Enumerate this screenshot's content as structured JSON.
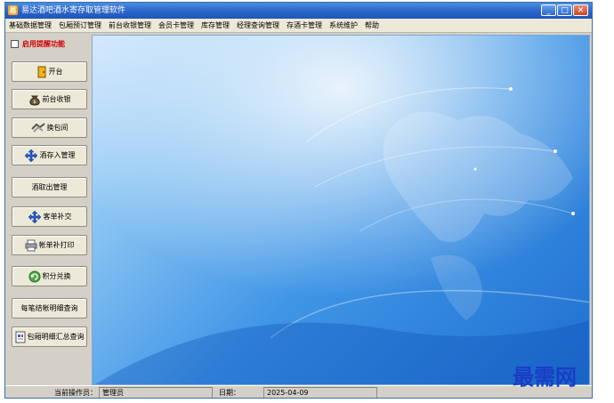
{
  "window": {
    "title": "易达酒吧酒水寄存取管理软件",
    "app_icon_glyph": "易"
  },
  "window_controls": {
    "minimize": "_",
    "maximize": "□",
    "close": "✕"
  },
  "menu": [
    "基础数据管理",
    "包厢预订管理",
    "前台收银管理",
    "会员卡管理",
    "库存管理",
    "经理查询管理",
    "存酒卡管理",
    "系统维护",
    "帮助"
  ],
  "sidebar": {
    "reminder_label": "启用提醒功能",
    "buttons": {
      "open_table": "开台",
      "front_cashier": "前台收银",
      "change_room": "换包间",
      "deposit_mgmt": "酒存入管理",
      "withdraw_mgmt": "酒取出管理",
      "order_supplement": "客单补交",
      "reprint_bill": "帐单补打印",
      "points_redeem": "积分兑换",
      "bill_detail_query": "每笔结帐明细查询",
      "room_summary_query": "包厢明细汇总查询"
    }
  },
  "status": {
    "operator_label": "当前操作员：",
    "operator_value": "管理员",
    "date_label": "日期：",
    "date_value": "2025-04-09"
  },
  "watermark": "最需网",
  "colors": {
    "title_bar": "#2a64c8",
    "reminder_text": "#d10000",
    "watermark": "#1a3cc6"
  }
}
